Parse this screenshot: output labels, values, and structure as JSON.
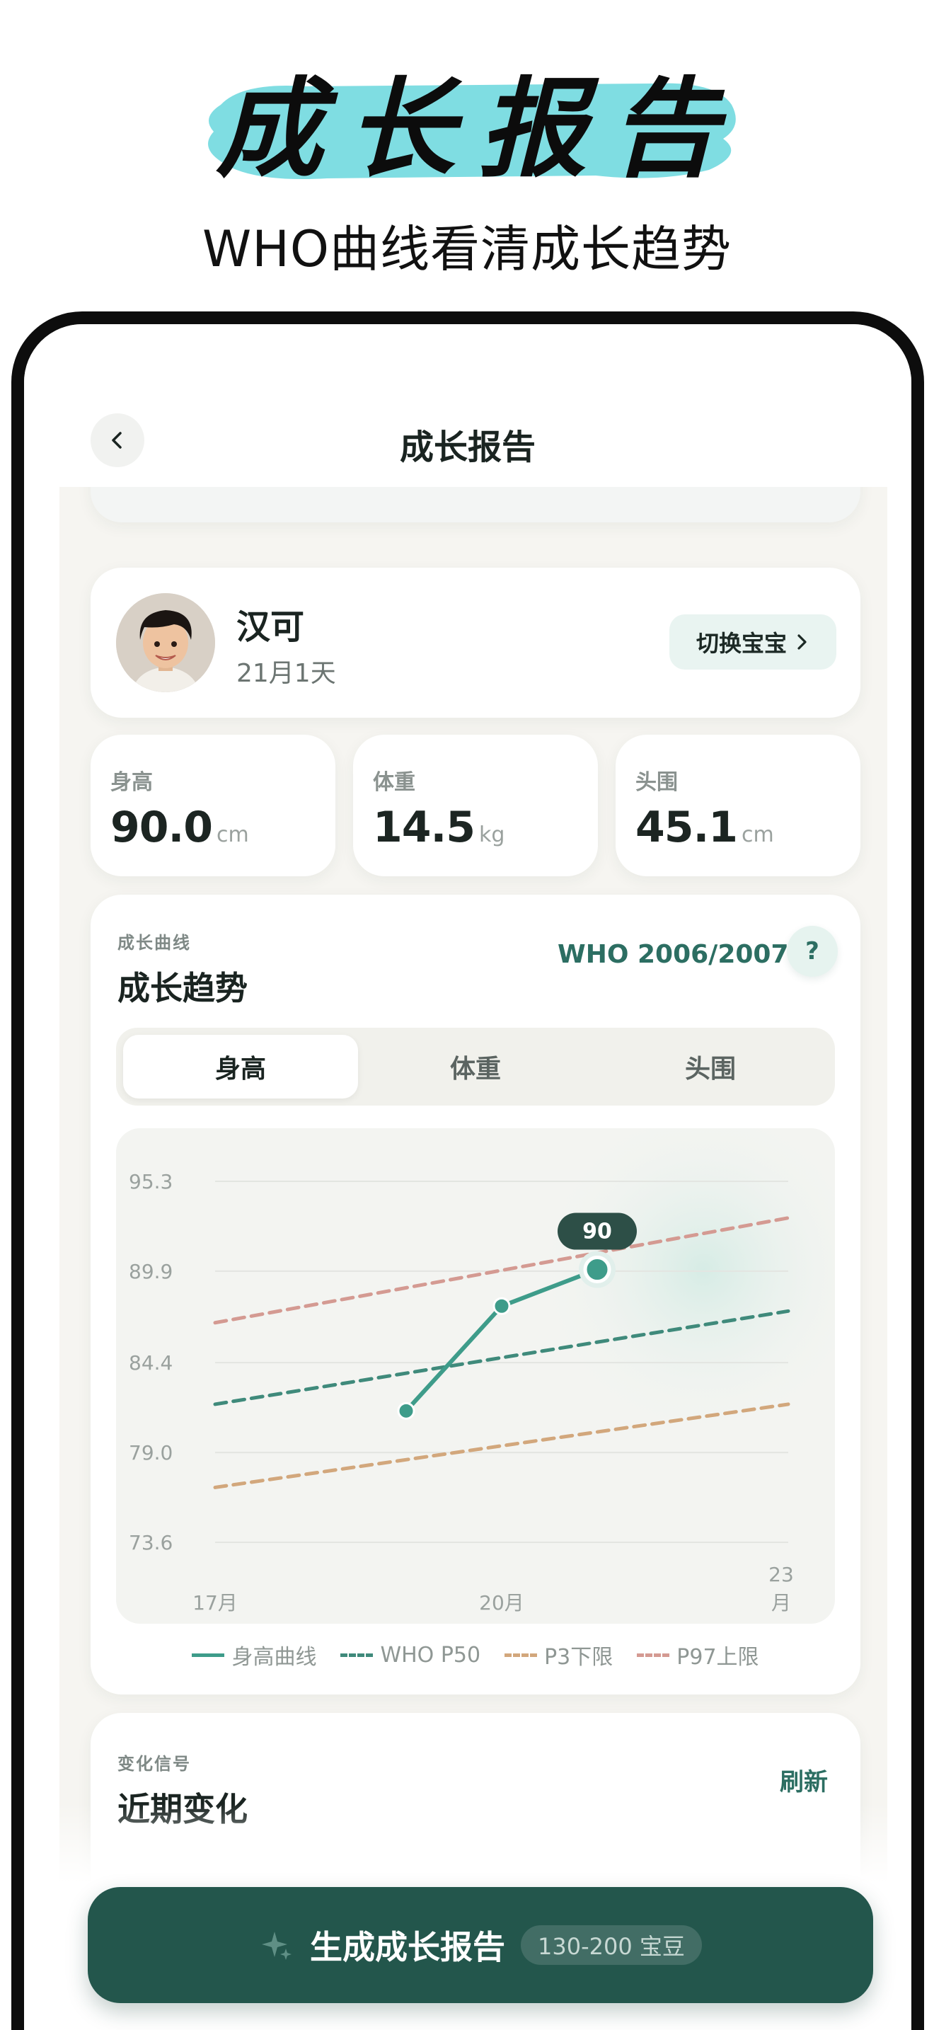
{
  "promo": {
    "title": "成长报告",
    "subtitle": "WHO曲线看清成长趋势",
    "brush_color": "#7fdde2"
  },
  "nav": {
    "back_icon": "chevron-left-icon",
    "title": "成长报告"
  },
  "baby": {
    "name": "汉可",
    "age": "21月1天",
    "switch_label": "切换宝宝"
  },
  "metrics": [
    {
      "label": "身高",
      "value": "90.0",
      "unit": "cm"
    },
    {
      "label": "体重",
      "value": "14.5",
      "unit": "kg"
    },
    {
      "label": "头围",
      "value": "45.1",
      "unit": "cm"
    }
  ],
  "trend": {
    "kicker": "成长曲线",
    "title": "成长趋势",
    "standard": "WHO 2006/2007",
    "help_label": "?",
    "tabs": [
      "身高",
      "体重",
      "头围"
    ],
    "active_tab": "身高"
  },
  "chart_data": {
    "type": "line",
    "ylim": [
      73.6,
      95.3
    ],
    "yticks": [
      "95.3",
      "89.9",
      "84.4",
      "79.0",
      "73.6"
    ],
    "xlim": [
      17,
      23
    ],
    "xticks": [
      {
        "x": 17,
        "label": "17月"
      },
      {
        "x": 20,
        "label": "20月"
      },
      {
        "x": 23,
        "label": "23\n月"
      }
    ],
    "series": [
      {
        "name": "身高曲线",
        "color": "#3e9c8a",
        "style": "solid",
        "points": [
          [
            19,
            81.5
          ],
          [
            20,
            87.8
          ],
          [
            21,
            90.0
          ]
        ]
      },
      {
        "name": "WHO P50",
        "color": "#3f8a7b",
        "style": "dashed",
        "points": [
          [
            17,
            81.9
          ],
          [
            23,
            87.5
          ]
        ]
      },
      {
        "name": "P3下限",
        "color": "#d2a77c",
        "style": "dashed",
        "points": [
          [
            17,
            76.9
          ],
          [
            23,
            81.9
          ]
        ]
      },
      {
        "name": "P97上限",
        "color": "#d49a92",
        "style": "dashed",
        "points": [
          [
            17,
            86.8
          ],
          [
            23,
            93.1
          ]
        ]
      }
    ],
    "highlight": {
      "x": 21,
      "y": 90.0,
      "label": "90"
    },
    "grid": true,
    "legend": "bottom"
  },
  "changes": {
    "kicker": "变化信号",
    "title": "近期变化",
    "refresh_label": "刷新"
  },
  "cta": {
    "icon": "sparkle-icon",
    "label": "生成成长报告",
    "cost": "130-200 宝豆"
  }
}
